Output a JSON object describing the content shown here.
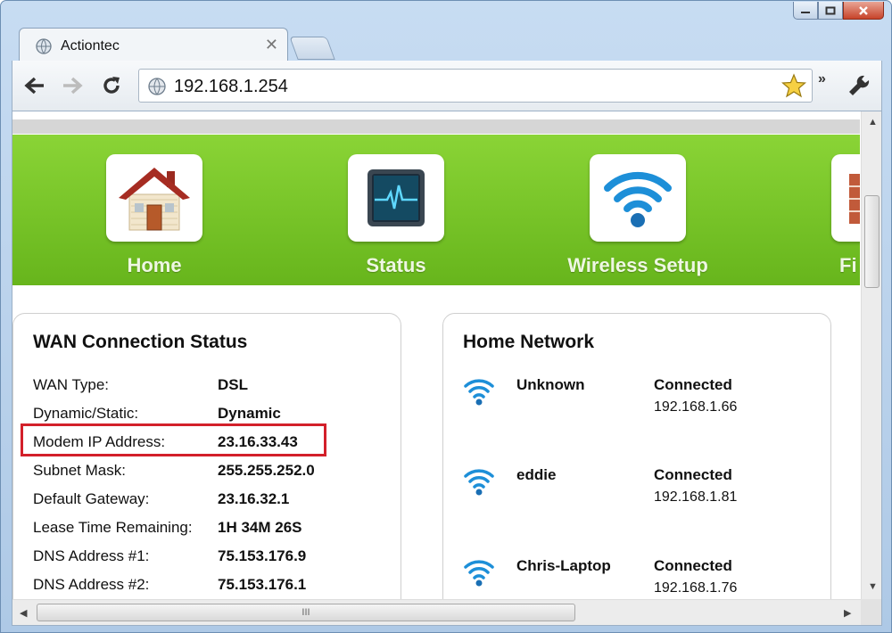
{
  "browser": {
    "tab_title": "Actiontec",
    "tab_close": "✕",
    "url": "192.168.1.254",
    "more": "»"
  },
  "nav": {
    "items": [
      {
        "label": "Home",
        "icon": "house-icon"
      },
      {
        "label": "Status",
        "icon": "monitor-pulse-icon"
      },
      {
        "label": "Wireless Setup",
        "icon": "wifi-icon"
      },
      {
        "label": "Fi",
        "icon": "firewall-brick-icon"
      }
    ]
  },
  "wan": {
    "title": "WAN Connection Status",
    "rows": [
      {
        "label": "WAN Type:",
        "value": "DSL"
      },
      {
        "label": "Dynamic/Static:",
        "value": "Dynamic"
      },
      {
        "label": "Modem IP Address:",
        "value": "23.16.33.43"
      },
      {
        "label": "Subnet Mask:",
        "value": "255.255.252.0"
      },
      {
        "label": "Default Gateway:",
        "value": "23.16.32.1"
      },
      {
        "label": "Lease Time Remaining:",
        "value": "1H 34M 26S"
      },
      {
        "label": "DNS Address #1:",
        "value": "75.153.176.9"
      },
      {
        "label": "DNS Address #2:",
        "value": "75.153.176.1"
      }
    ]
  },
  "home_network": {
    "title": "Home Network",
    "devices": [
      {
        "name": "Unknown",
        "status": "Connected",
        "ip": "192.168.1.66"
      },
      {
        "name": "eddie",
        "status": "Connected",
        "ip": "192.168.1.81"
      },
      {
        "name": "Chris-Laptop",
        "status": "Connected",
        "ip": "192.168.1.76"
      }
    ]
  },
  "scrollbar": {
    "grip": "III"
  },
  "colors": {
    "banner_green": "#74c226",
    "highlight_red": "#d3202a",
    "wifi_blue": "#1d8fd8"
  }
}
